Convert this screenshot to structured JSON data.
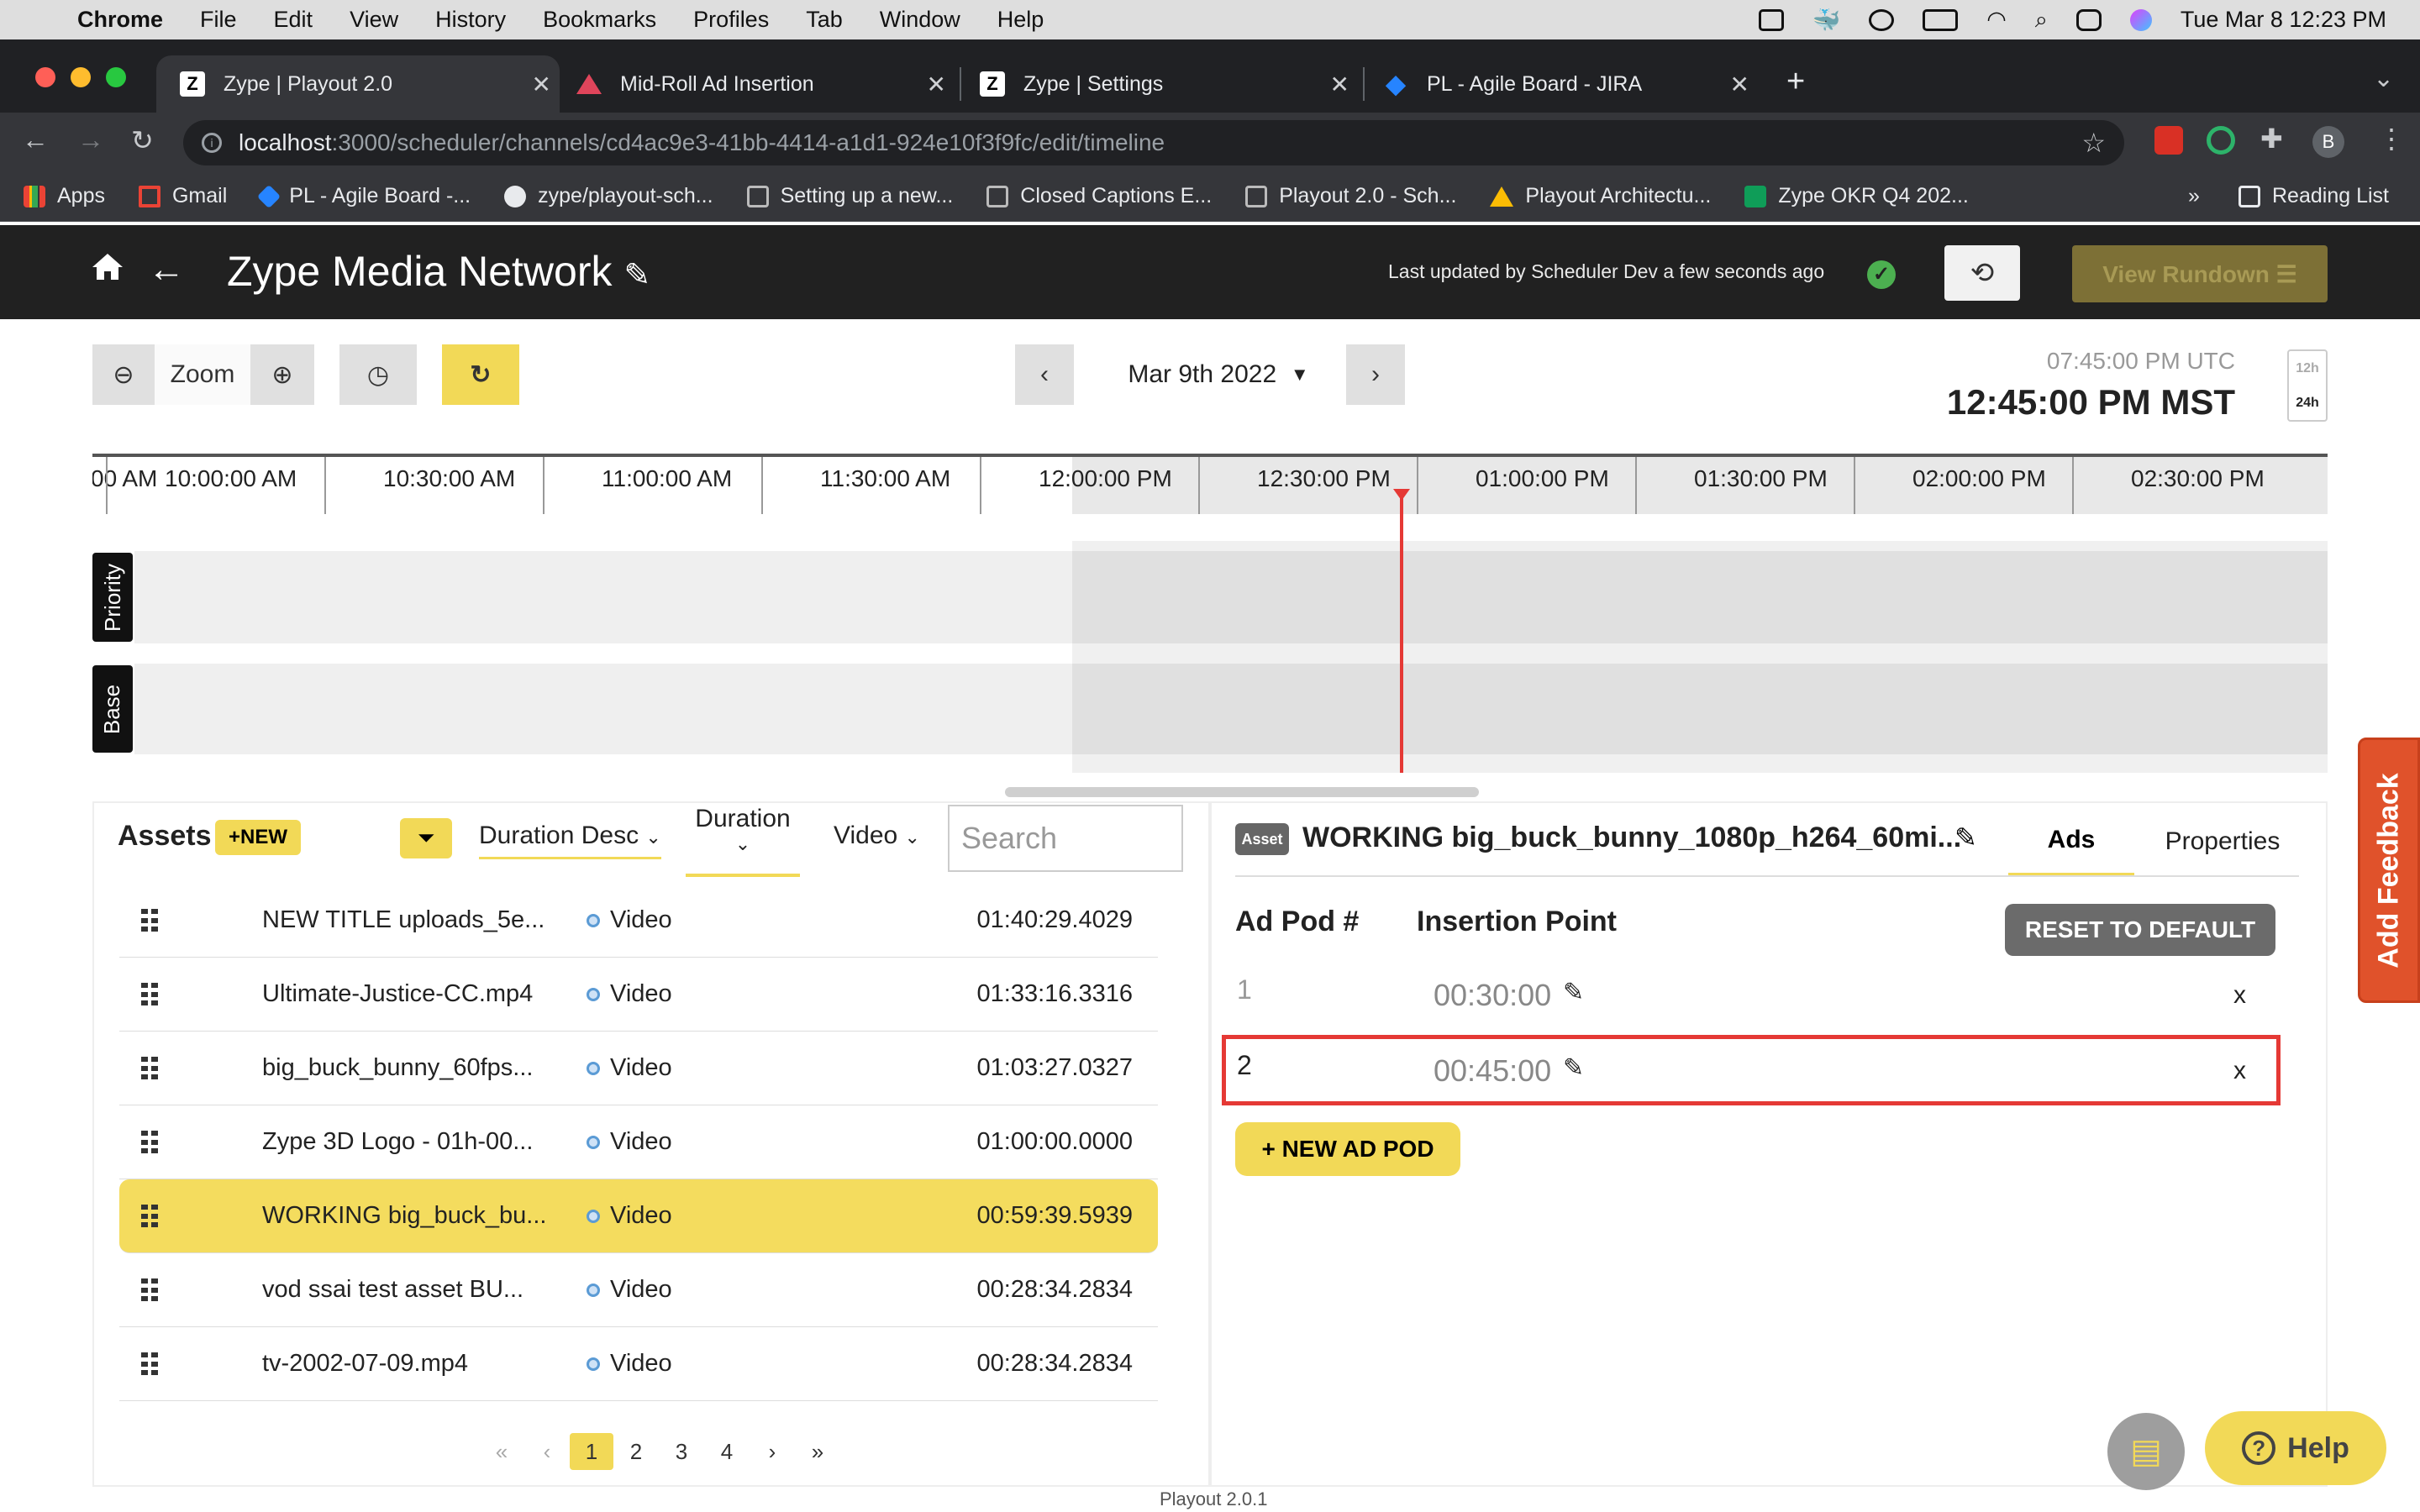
{
  "menubar": {
    "app": "Chrome",
    "items": [
      "File",
      "Edit",
      "View",
      "History",
      "Bookmarks",
      "Profiles",
      "Tab",
      "Window",
      "Help"
    ],
    "clock": "Tue Mar 8  12:23 PM"
  },
  "tabs": [
    {
      "title": "Zype | Playout 2.0",
      "icon": "Z"
    },
    {
      "title": "Mid-Roll Ad Insertion",
      "icon": "triangle"
    },
    {
      "title": "Zype | Settings",
      "icon": "Z"
    },
    {
      "title": "PL - Agile Board - JIRA",
      "icon": "jira"
    }
  ],
  "url": {
    "host": "localhost",
    "path": ":3000/scheduler/channels/cd4ac9e3-41bb-4414-a1d1-924e10f3f9fc/edit/timeline"
  },
  "bookmarks": [
    "Apps",
    "Gmail",
    "PL - Agile Board -...",
    "zype/playout-sch...",
    "Setting up a new...",
    "Closed Captions E...",
    "Playout 2.0 - Sch...",
    "Playout Architectu...",
    "Zype OKR Q4 202..."
  ],
  "bookmarks_more": "»",
  "reading_list": "Reading List",
  "header": {
    "title": "Zype Media Network",
    "last_updated": "Last updated by Scheduler Dev a few seconds ago",
    "view_rundown": "View Rundown ☰"
  },
  "controls": {
    "zoom": "Zoom",
    "date": "Mar 9th 2022",
    "utc_time": "07:45:00 PM UTC",
    "local_time": "12:45:00 PM MST",
    "fmt_12": "12h",
    "fmt_24": "24h"
  },
  "timeline": {
    "ticks": [
      "00 AM",
      "10:00:00 AM",
      "10:30:00 AM",
      "11:00:00 AM",
      "11:30:00 AM",
      "12:00:00 PM",
      "12:30:00 PM",
      "01:00:00 PM",
      "01:30:00 PM",
      "02:00:00 PM",
      "02:30:00 PM"
    ],
    "lanes": [
      "Priority",
      "Base"
    ]
  },
  "assets": {
    "title": "Assets",
    "new_label": "+NEW",
    "sort": "Duration Desc",
    "duration_filter": "Duration",
    "type_filter": "Video",
    "search_placeholder": "Search",
    "rows": [
      {
        "name": "NEW TITLE uploads_5e...",
        "type": "Video",
        "duration": "01:40:29.4029"
      },
      {
        "name": "Ultimate-Justice-CC.mp4",
        "type": "Video",
        "duration": "01:33:16.3316"
      },
      {
        "name": "big_buck_bunny_60fps...",
        "type": "Video",
        "duration": "01:03:27.0327"
      },
      {
        "name": "Zype 3D Logo - 01h-00...",
        "type": "Video",
        "duration": "01:00:00.0000"
      },
      {
        "name": "WORKING big_buck_bu...",
        "type": "Video",
        "duration": "00:59:39.5939"
      },
      {
        "name": "vod ssai test asset BU...",
        "type": "Video",
        "duration": "00:28:34.2834"
      },
      {
        "name": "tv-2002-07-09.mp4",
        "type": "Video",
        "duration": "00:28:34.2834"
      }
    ],
    "selected_index": 4,
    "pages": [
      "1",
      "2",
      "3",
      "4"
    ],
    "current_page": "1"
  },
  "detail": {
    "tag": "Asset",
    "name": "WORKING big_buck_bunny_1080p_h264_60mi...",
    "tab_ads": "Ads",
    "tab_properties": "Properties",
    "col_pod": "Ad Pod #",
    "col_insertion": "Insertion Point",
    "reset": "RESET TO DEFAULT",
    "pods": [
      {
        "num": "1",
        "time": "00:30:00"
      },
      {
        "num": "2",
        "time": "00:45:00"
      }
    ],
    "new_pod": "+ NEW AD POD"
  },
  "feedback": "Add Feedback",
  "help": "Help",
  "version": "Playout 2.0.1",
  "colors": {
    "accent": "#f2d957",
    "now_line": "#e53935",
    "header_bg": "#212121"
  }
}
